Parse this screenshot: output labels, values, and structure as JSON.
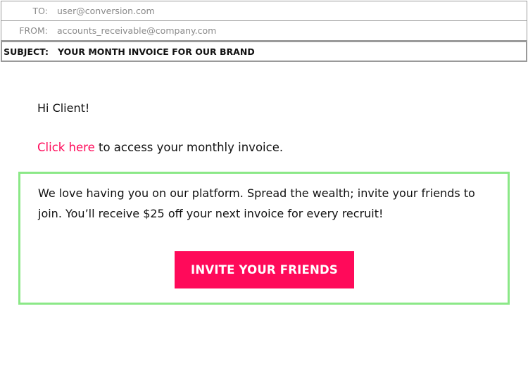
{
  "header": {
    "to": {
      "label": "TO:",
      "value": "user@conversion.com"
    },
    "from": {
      "label": "FROM:",
      "value": "accounts_receivable@company.com"
    },
    "subject": {
      "label": "SUBJECT:",
      "value": "YOUR MONTH INVOICE FOR OUR BRAND"
    }
  },
  "body": {
    "greeting": "Hi Client!",
    "link_text": "Click here",
    "access_text": " to access your monthly invoice.",
    "promo_text": "We love having you on our platform. Spread the wealth; invite your friends to join. You’ll receive $25 off your next invoice for every recruit!",
    "invite_button": "INVITE YOUR FRIENDS"
  },
  "colors": {
    "accent": "#ff0a5a",
    "promo_border": "#8be887",
    "header_border": "#9a9a9a"
  }
}
